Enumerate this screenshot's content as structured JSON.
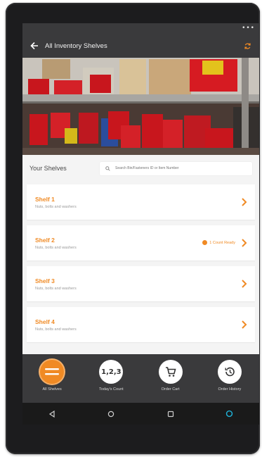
{
  "status": {
    "dots": "•••"
  },
  "appbar": {
    "title": "All Inventory Shelves"
  },
  "shelves_header": {
    "title": "Your Shelves",
    "search_placeholder": "Search Bin/Fasteners ID or Item Number"
  },
  "shelves": [
    {
      "name": "Shelf 1",
      "desc": "Nuts, bolts and washers",
      "count": ""
    },
    {
      "name": "Shelf 2",
      "desc": "Nuts, bolts and washers",
      "count": "1 Count Ready"
    },
    {
      "name": "Shelf 3",
      "desc": "Nuts, bolts and washers",
      "count": ""
    },
    {
      "name": "Shelf 4",
      "desc": "Nuts, bolts and washers",
      "count": ""
    }
  ],
  "bottom_nav": [
    {
      "label": "All Shelves",
      "icon": "list-icon",
      "active": true
    },
    {
      "label": "Today's Count",
      "icon": "number-icon",
      "text": "1,2,3",
      "active": false
    },
    {
      "label": "Order Cart",
      "icon": "cart-icon",
      "active": false
    },
    {
      "label": "Order History",
      "icon": "history-icon",
      "active": false
    }
  ],
  "colors": {
    "accent": "#f08a24",
    "appbar": "#3a3a3c",
    "background": "#f4f4f4"
  }
}
